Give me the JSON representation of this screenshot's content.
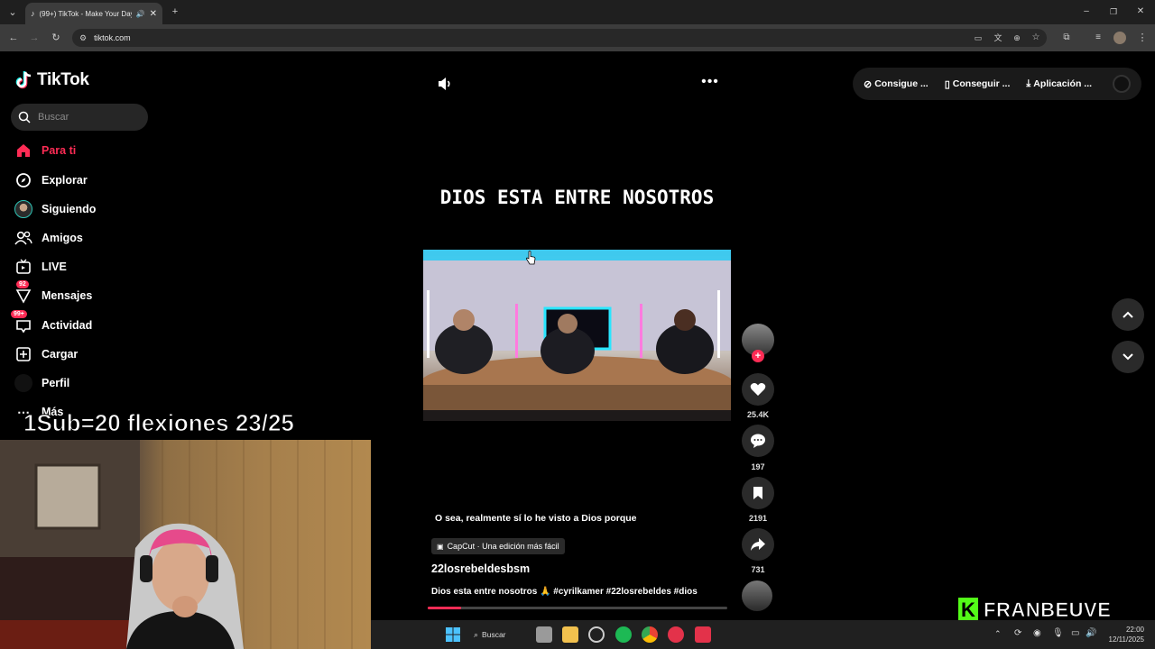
{
  "browser": {
    "tab_title": "(99+) TikTok - Make Your Day",
    "url": "tiktok.com",
    "new_tab_icon": "plus-icon"
  },
  "sidebar": {
    "logo_text": "TikTok",
    "search_placeholder": "Buscar",
    "items": [
      {
        "label": "Para ti",
        "icon": "home-icon",
        "active": true
      },
      {
        "label": "Explorar",
        "icon": "compass-icon"
      },
      {
        "label": "Siguiendo",
        "icon": "following-avatar"
      },
      {
        "label": "Amigos",
        "icon": "friends-icon"
      },
      {
        "label": "LIVE",
        "icon": "live-icon"
      },
      {
        "label": "Mensajes",
        "icon": "messages-icon",
        "badge": "92"
      },
      {
        "label": "Actividad",
        "icon": "inbox-icon",
        "badge": "99+"
      },
      {
        "label": "Cargar",
        "icon": "upload-icon"
      },
      {
        "label": "Perfil",
        "icon": "profile-avatar"
      },
      {
        "label": "Más",
        "icon": "more-icon"
      }
    ]
  },
  "overlay": {
    "sub_counter": "1Sub=20 flexiones 23/25",
    "brand_name": "FRANBEUVE",
    "brand_letter": "K"
  },
  "top_actions": {
    "coins": "Consigue ...",
    "get_app": "Conseguir ...",
    "download": "Aplicación ..."
  },
  "video": {
    "caption": "DIOS ESTA ENTRE NOSOTROS",
    "subtitle": "O sea, realmente sí lo he visto a Dios porque",
    "capcut_label": "CapCut · Una edición más fácil",
    "author": "22losrebeldesbsm",
    "description": "Dios esta entre nosotros 🙏 #cyrilkamer #22losrebeldes #dios",
    "progress": 0.11
  },
  "actions": {
    "likes": "25.4K",
    "comments": "197",
    "saves": "2191",
    "shares": "731"
  },
  "taskbar": {
    "search_label": "Buscar",
    "time": "22:00",
    "date": "12/11/2025"
  },
  "colors": {
    "accent": "#fe2c55",
    "kick_green": "#53fc18"
  }
}
